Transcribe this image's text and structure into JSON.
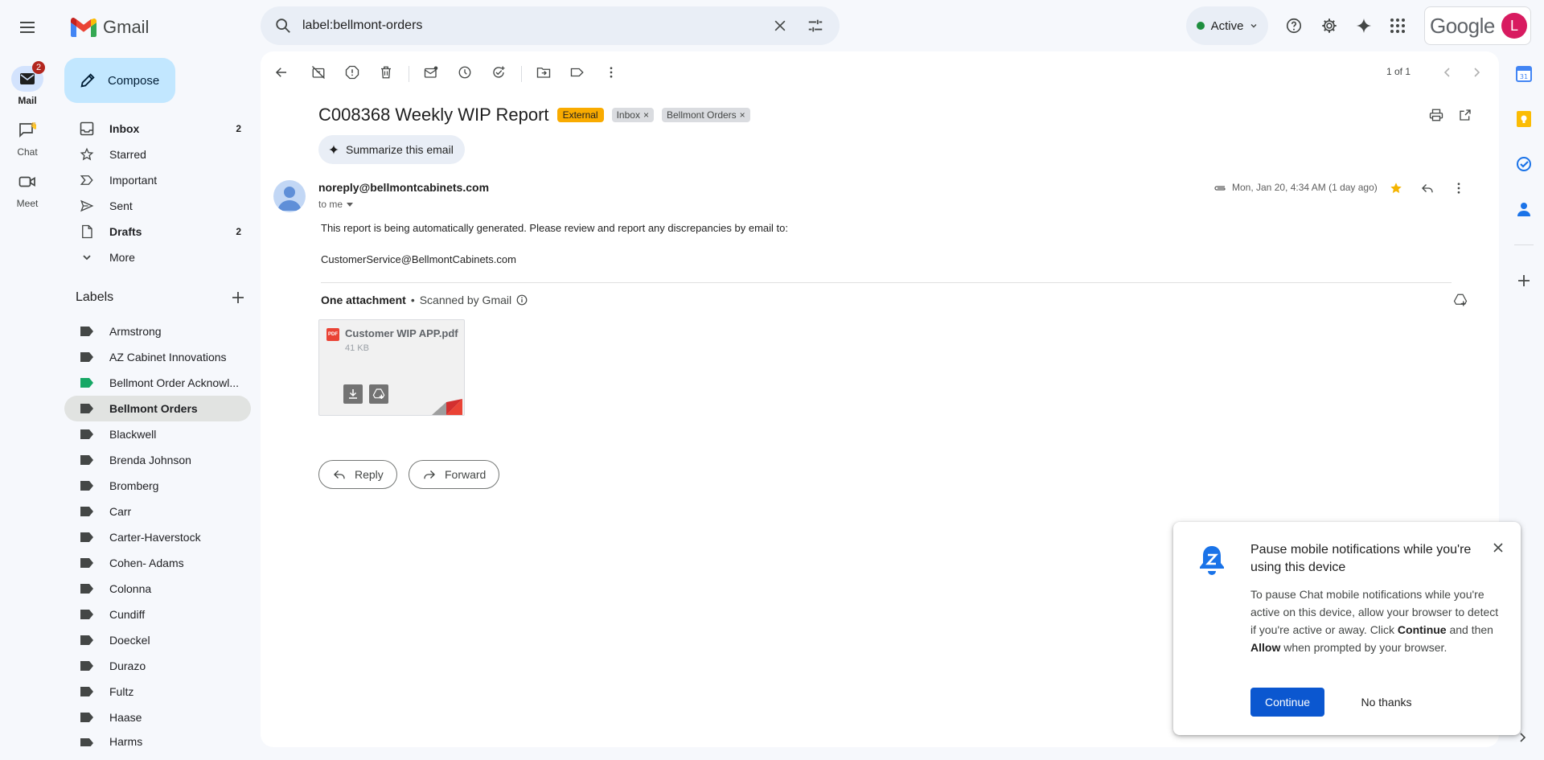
{
  "app": {
    "name": "Gmail",
    "status": "Active",
    "google_word": "Google",
    "avatar_letter": "L"
  },
  "search": {
    "query": "label:bellmont-orders"
  },
  "rail": [
    {
      "label": "Mail",
      "badge": "2"
    },
    {
      "label": "Chat"
    },
    {
      "label": "Meet"
    }
  ],
  "sidebar": {
    "compose_label": "Compose",
    "nav": [
      {
        "label": "Inbox",
        "count": "2"
      },
      {
        "label": "Starred",
        "count": ""
      },
      {
        "label": "Important",
        "count": ""
      },
      {
        "label": "Sent",
        "count": ""
      },
      {
        "label": "Drafts",
        "count": "2"
      },
      {
        "label": "More",
        "count": ""
      }
    ],
    "labels_title": "Labels",
    "labels": [
      "Armstrong",
      "AZ Cabinet Innovations",
      "Bellmont Order Acknowl...",
      "Bellmont Orders",
      "Blackwell",
      "Brenda Johnson",
      "Bromberg",
      "Carr",
      "Carter-Haverstock",
      "Cohen- Adams",
      "Colonna",
      "Cundiff",
      "Doeckel",
      "Durazo",
      "Fultz",
      "Haase",
      "Harms"
    ],
    "label_color_green": "#16a765"
  },
  "toolbar": {
    "pager": "1 of 1"
  },
  "email": {
    "subject": "C008368 Weekly WIP Report",
    "chips": {
      "external": "External",
      "inbox": "Inbox",
      "bellmont": "Bellmont Orders"
    },
    "summarize": "Summarize this email",
    "sender": "noreply@bellmontcabinets.com",
    "to": "to me",
    "date": "Mon, Jan 20, 4:34 AM (1 day ago)",
    "body_line1": "This report is being automatically generated. Please review and report any discrepancies by email to:",
    "body_line2": "CustomerService@BellmontCabinets.com",
    "attachments_title": "One attachment",
    "scanned": "Scanned by Gmail",
    "attachment": {
      "name": "Customer WIP APP.pdf",
      "size": "41 KB",
      "type_badge": "PDF"
    },
    "reply": "Reply",
    "forward": "Forward"
  },
  "popup": {
    "title": "Pause mobile notifications while you're using this device",
    "text_a": "To pause Chat mobile notifications while you're active on this device, allow your browser to detect if you're active or away. Click ",
    "text_continue": "Continue",
    "text_b": " and then ",
    "text_allow": "Allow",
    "text_c": " when prompted by your browser.",
    "continue": "Continue",
    "no_thanks": "No thanks"
  },
  "colors": {
    "compose_bg": "#c2e7ff",
    "primary_button": "#0b57d0",
    "external_chip": "#f9ab00",
    "badge": "#b3261e"
  }
}
